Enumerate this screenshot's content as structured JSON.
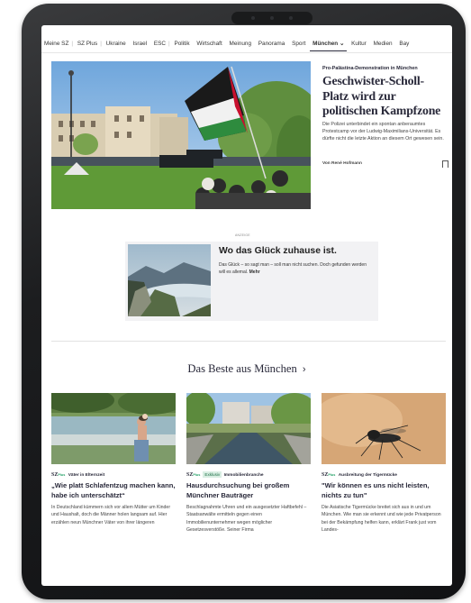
{
  "nav": {
    "items": [
      "Meine SZ",
      "SZ Plus",
      "Ukraine",
      "Israel",
      "ESC",
      "Politik",
      "Wirtschaft",
      "Meinung",
      "Panorama",
      "Sport",
      "München",
      "Kultur",
      "Medien",
      "Bay"
    ],
    "dropdown_glyph": "⌄"
  },
  "hero": {
    "kicker": "Pro-Palästina-Demonstration in München",
    "title": "Geschwister-Scholl-Platz wird zur politischen Kampfzone",
    "teaser": "Die Polizei unterbindet ein spontan anberaumtes Protestcamp vor der Ludwig-Maximilians-Universität. Es dürfte nicht die letzte Aktion an diesem Ort gewesen sein.",
    "author": "Von René Hofmann"
  },
  "ad": {
    "label": "ANZEIGE",
    "title": "Wo das Glück zuhause ist.",
    "text": "Das Glück – so sagt man – soll man nicht suchen. Doch gefunden werden will es allemal.",
    "more": "Mehr"
  },
  "section": {
    "title": "Das Beste aus München",
    "arrow": "›"
  },
  "cards": [
    {
      "brand": "SZ",
      "plus": "Plus",
      "badge": "",
      "kicker": "Väter in Elternzeit",
      "title": "„Wie platt Schlafentzug machen kann, habe ich unterschätzt“",
      "teaser": "In Deutschland kümmern sich vor allem Mütter um Kinder und Haushalt, doch die Männer holen langsam auf. Hier erzählen neun Münchner Väter von ihrer längeren"
    },
    {
      "brand": "SZ",
      "plus": "Plus",
      "badge": "Exklusiv",
      "kicker": "Immobilienbranche",
      "title": "Hausdurchsuchung bei großem Münchner Bauträger",
      "teaser": "Beschlagnahmte Uhren und ein ausgesetzter Haftbefehl – Staatsanwälte ermitteln gegen einen Immobilienunternehmer wegen möglicher Gesetzesverstöße. Seiner Firma"
    },
    {
      "brand": "SZ",
      "plus": "Plus",
      "badge": "",
      "kicker": "Ausbreitung der Tigermücke",
      "title": "\"Wir können es uns nicht leisten, nichts zu tun\"",
      "teaser": "Die Asiatische Tigermücke breitet sich aus in und um München. Wie man sie erkennt und wie jede Privatperson bei der Bekämpfung helfen kann, erklärt Frank just vom Landes-"
    }
  ],
  "colors": {
    "brand_dark": "#29293a",
    "plus_green": "#28a36a",
    "badge_bg": "#d9eee3"
  }
}
